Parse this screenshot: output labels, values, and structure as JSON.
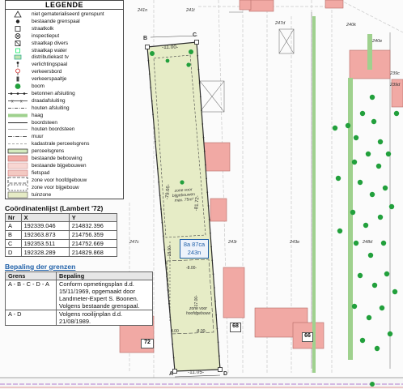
{
  "legend": {
    "title": "LEGENDE",
    "items": [
      {
        "label": "niet gematerialiseerd grenspunt",
        "sym": "triangle"
      },
      {
        "label": "bestaande grenspaal",
        "sym": "dot"
      },
      {
        "label": "straatkolk",
        "sym": "square"
      },
      {
        "label": "inspectieput",
        "sym": "circle-x"
      },
      {
        "label": "straatkap divers",
        "sym": "diamond-sq"
      },
      {
        "label": "straatkap water",
        "sym": "square-sm"
      },
      {
        "label": "distributiekast tv",
        "sym": "rect-green"
      },
      {
        "label": "verlichtingspaal",
        "sym": "post"
      },
      {
        "label": "verkeersbord",
        "sym": "sign"
      },
      {
        "label": "verkeerspaaltje",
        "sym": "bollard"
      },
      {
        "label": "boom",
        "sym": "tree"
      },
      {
        "label": "betonnen afsluiting",
        "sym": "line-dots"
      },
      {
        "label": "draadafsluiting",
        "sym": "line-x"
      },
      {
        "label": "houten afsluiting",
        "sym": "line-dash"
      },
      {
        "label": "haag",
        "sym": "hedge"
      },
      {
        "label": "boordsteen",
        "sym": "line-solid"
      },
      {
        "label": "houten boordsteen",
        "sym": "line-thin"
      },
      {
        "label": "muur",
        "sym": "line-dashdot"
      },
      {
        "label": "kadastrale perceelsgrens",
        "sym": "line-dashed"
      },
      {
        "label": "perceelsgrens",
        "sym": "bar-green"
      },
      {
        "label": "bestaande bebouwing",
        "sym": "fill-pink"
      },
      {
        "label": "bestaande bijgebouwen",
        "sym": "fill-lightpink"
      },
      {
        "label": "fietspad",
        "sym": "fill-bike"
      },
      {
        "label": "zone voor hoofdgebouw",
        "sym": "zone-main"
      },
      {
        "label": "zone voor bijgebouw",
        "sym": "zone-annex"
      },
      {
        "label": "tuinzone",
        "sym": "zone-garden"
      }
    ]
  },
  "coordinates": {
    "title": "Coördinatenlijst (Lambert '72)",
    "headers": [
      "Nr",
      "X",
      "Y"
    ],
    "rows": [
      [
        "A",
        "192339.046",
        "214832.396"
      ],
      [
        "B",
        "192363.873",
        "214756.359"
      ],
      [
        "C",
        "192353.511",
        "214752.669"
      ],
      [
        "D",
        "192328.289",
        "214829.868"
      ]
    ]
  },
  "boundaries": {
    "title": "Bepaling der grenzen",
    "headers": [
      "Grens",
      "Bepaling"
    ],
    "rows": [
      [
        "A - B - C - D - A",
        "Conform opmetingsplan d.d. 15/11/1969, opgemaakt door Landmeter-Expert S. Boonen. Volgens bestaande grenspaal."
      ],
      [
        "A - D",
        "Volgens rooilijnplan d.d. 21/08/1989."
      ]
    ]
  },
  "map": {
    "points": {
      "A": "A",
      "B": "B",
      "C": "C",
      "D": "D"
    },
    "dims": {
      "top": "-11.00-",
      "bottom": "-11.05-",
      "left_side": "-79.66-",
      "right_side": "-81.72-",
      "side_a": "-18.00-",
      "side_b": "-17.00-",
      "mid_width": "-8.00-",
      "lower_width": "-8.00-",
      "offset": "3.00"
    },
    "zones": {
      "annex": "zone voor bijgebouwen\nmax. 75m²",
      "main": "zone voor hoofdgebouw",
      "parcel_area": "8a 87ca",
      "parcel_id": "243n"
    },
    "parcel_labels": [
      "241n",
      "241t",
      "247d",
      "240k",
      "240e",
      "239c",
      "239d",
      "247c",
      "243r",
      "243e",
      "248d"
    ],
    "house_numbers": [
      "72",
      "68",
      "66"
    ]
  },
  "colors": {
    "parcel_fill": "#e6ecc6",
    "building": "#f1a9a4",
    "tree": "#22a03c",
    "hedge": "#9fd18e",
    "boundary": "#2b2b2b"
  }
}
